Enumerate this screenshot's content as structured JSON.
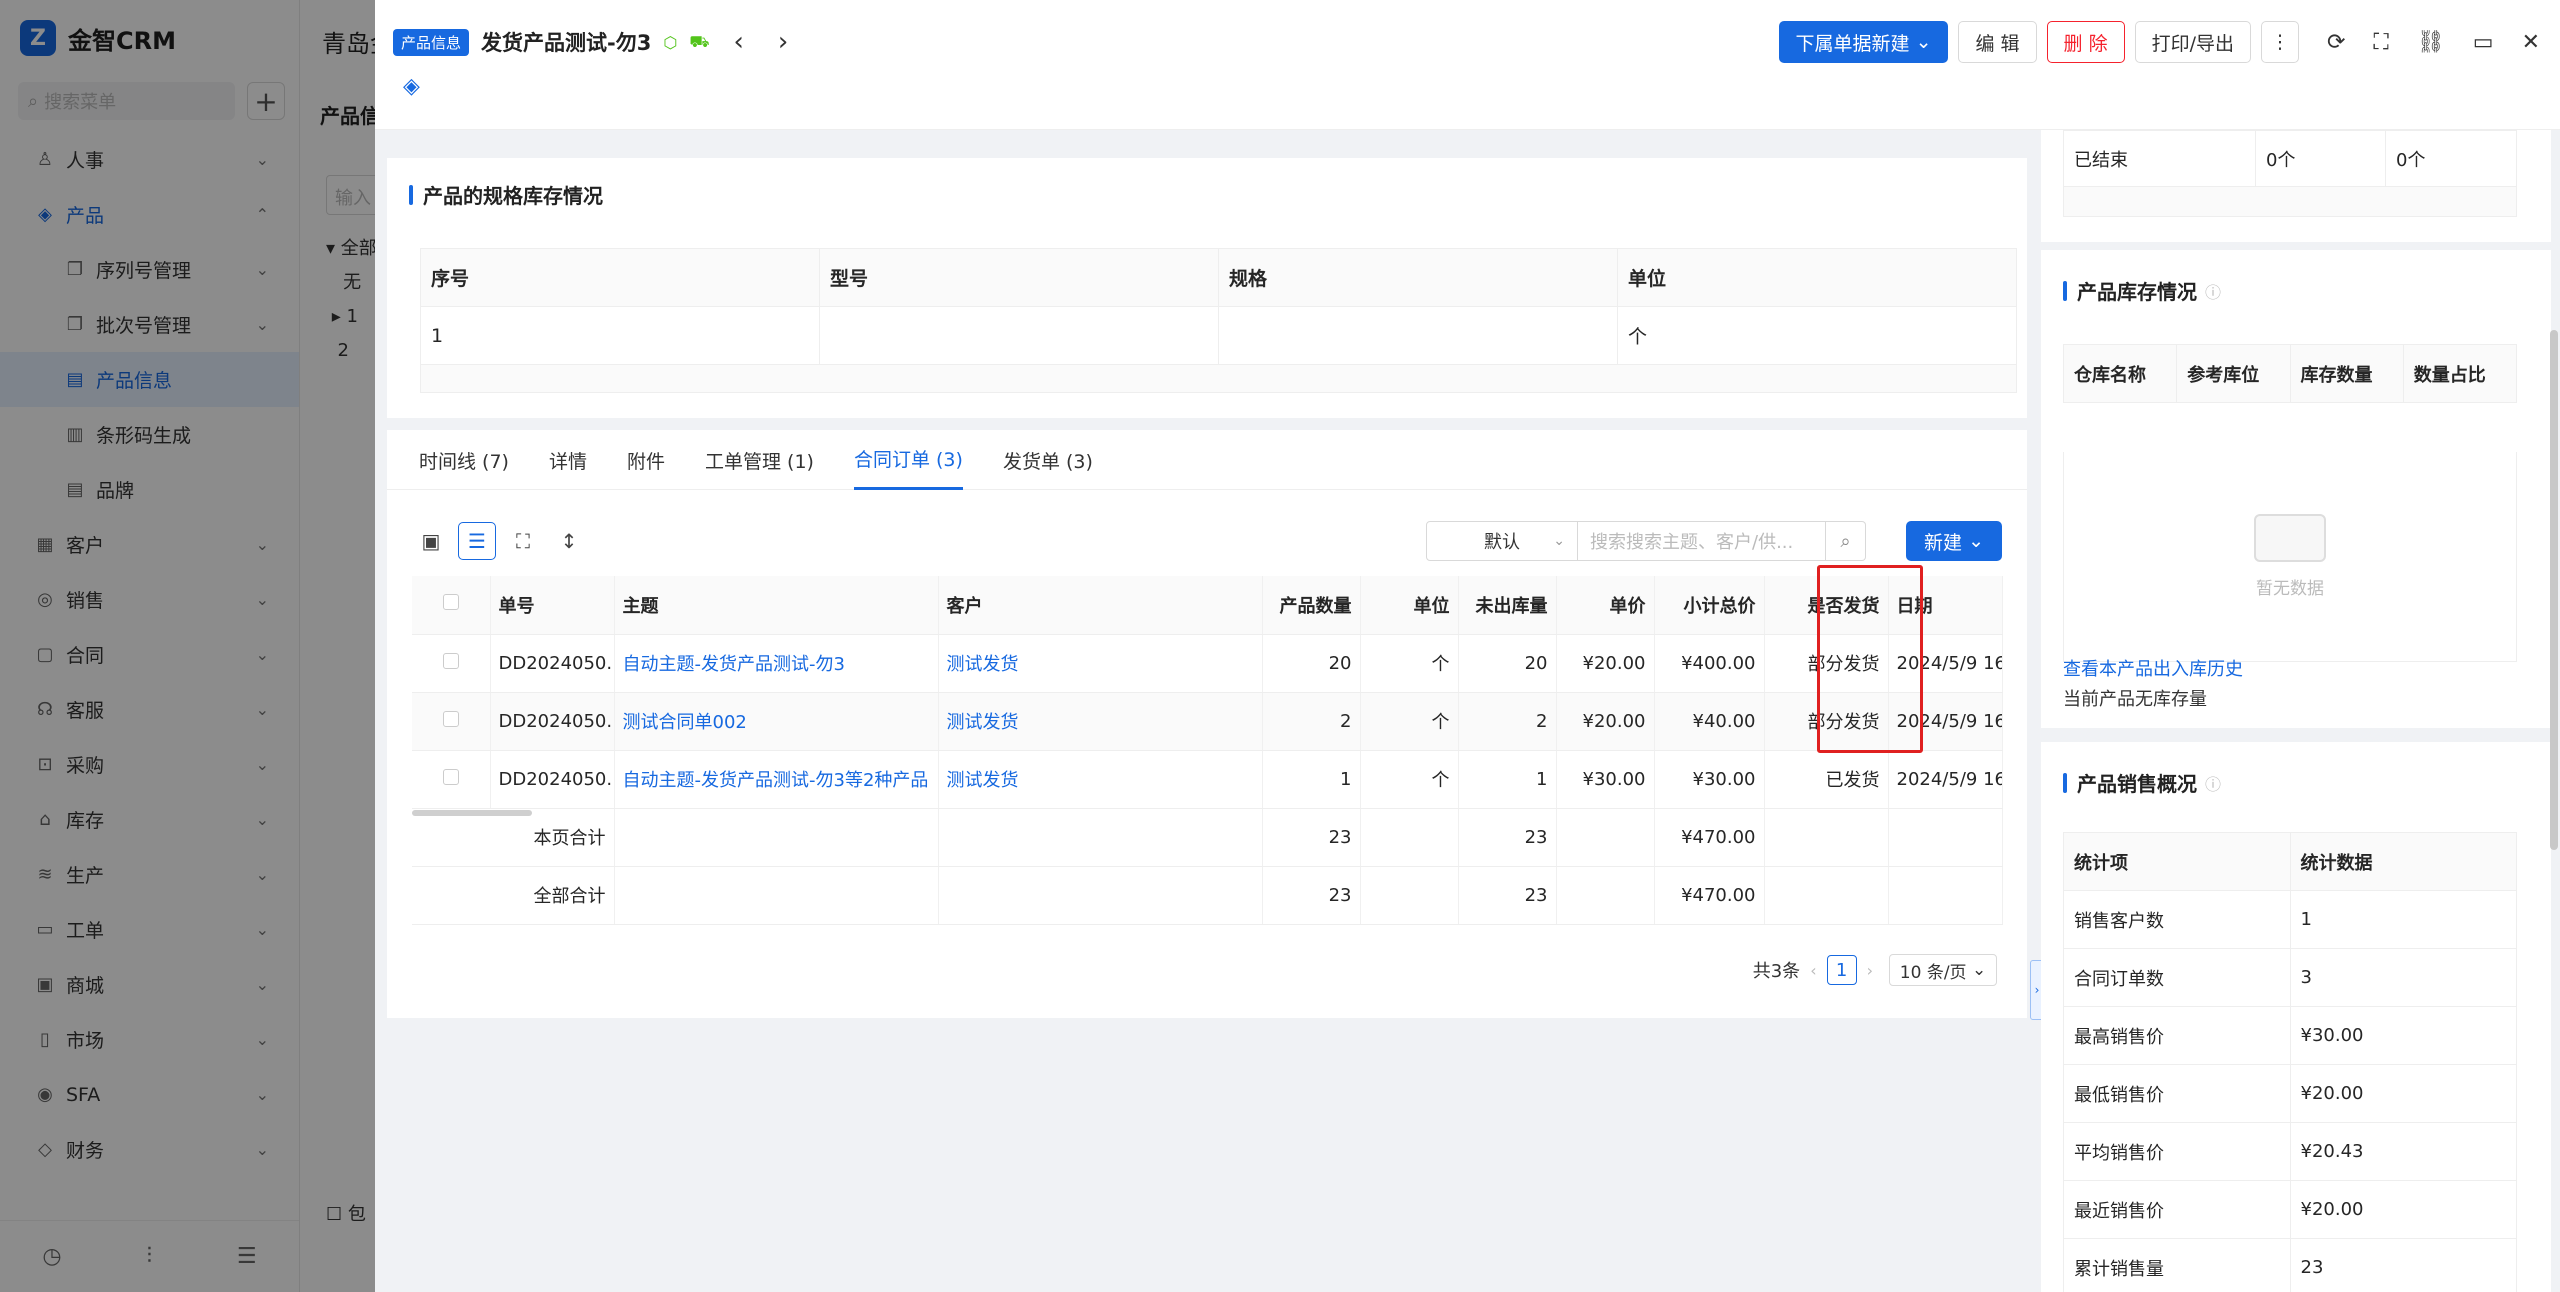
{
  "app": {
    "name": "金智CRM"
  },
  "sidebar": {
    "search_placeholder": "搜索菜单",
    "items": [
      {
        "label": "人事",
        "icon": "person-icon",
        "level": 1
      },
      {
        "label": "产品",
        "icon": "product-icon",
        "level": 1,
        "expanded": true
      },
      {
        "label": "序列号管理",
        "icon": "serial-icon",
        "level": 2
      },
      {
        "label": "批次号管理",
        "icon": "batch-icon",
        "level": 2
      },
      {
        "label": "产品信息",
        "icon": "doc-icon",
        "level": 2,
        "selected": true
      },
      {
        "label": "条形码生成",
        "icon": "barcode-icon",
        "level": 2
      },
      {
        "label": "品牌",
        "icon": "doc-icon",
        "level": 2
      },
      {
        "label": "客户",
        "icon": "customer-icon",
        "level": 1
      },
      {
        "label": "销售",
        "icon": "sales-icon",
        "level": 1
      },
      {
        "label": "合同",
        "icon": "contract-icon",
        "level": 1
      },
      {
        "label": "客服",
        "icon": "service-icon",
        "level": 1
      },
      {
        "label": "采购",
        "icon": "purchase-icon",
        "level": 1
      },
      {
        "label": "库存",
        "icon": "stock-icon",
        "level": 1
      },
      {
        "label": "生产",
        "icon": "production-icon",
        "level": 1
      },
      {
        "label": "工单",
        "icon": "workorder-icon",
        "level": 1
      },
      {
        "label": "商城",
        "icon": "mall-icon",
        "level": 1
      },
      {
        "label": "市场",
        "icon": "market-icon",
        "level": 1
      },
      {
        "label": "SFA",
        "icon": "sfa-icon",
        "level": 1
      },
      {
        "label": "财务",
        "icon": "finance-icon",
        "level": 1
      }
    ]
  },
  "background_page": {
    "title": "青岛金",
    "subtitle": "产品信",
    "input_placeholder": "输入",
    "tree": [
      "全部",
      "无",
      "1",
      "2"
    ],
    "checkbox_label": "包"
  },
  "drawer": {
    "tag": "产品信息",
    "title": "发货产品测试-勿3",
    "actions": {
      "sub_new": "下属单据新建",
      "edit": "编 辑",
      "delete": "删 除",
      "print": "打印/导出"
    },
    "spec_panel": {
      "title": "产品的规格库存情况",
      "columns": [
        "序号",
        "型号",
        "规格",
        "单位"
      ],
      "rows": [
        [
          "1",
          "",
          "",
          "个"
        ]
      ]
    },
    "tabs": [
      {
        "label": "时间线 (7)"
      },
      {
        "label": "详情"
      },
      {
        "label": "附件"
      },
      {
        "label": "工单管理 (1)"
      },
      {
        "label": "合同订单 (3)",
        "active": true
      },
      {
        "label": "发货单 (3)"
      }
    ],
    "order_toolbar": {
      "sort_default": "默认",
      "search_placeholder": "搜索搜索主题、客户/供...",
      "new_label": "新建"
    },
    "orders": {
      "columns": [
        "单号",
        "主题",
        "客户",
        "产品数量",
        "单位",
        "未出库量",
        "单价",
        "小计总价",
        "是否发货",
        "日期"
      ],
      "rows": [
        [
          "DD2024050...",
          "自动主题-发货产品测试-勿3",
          "测试发货",
          "20",
          "个",
          "20",
          "¥20.00",
          "¥400.00",
          "部分发货",
          "2024/5/9 16:"
        ],
        [
          "DD2024050...",
          "测试合同单002",
          "测试发货",
          "2",
          "个",
          "2",
          "¥20.00",
          "¥40.00",
          "部分发货",
          "2024/5/9 16:"
        ],
        [
          "DD2024050...",
          "自动主题-发货产品测试-勿3等2种产品",
          "测试发货",
          "1",
          "个",
          "1",
          "¥30.00",
          "¥30.00",
          "已发货",
          "2024/5/9 16:"
        ]
      ],
      "page_total": {
        "label": "本页合计",
        "qty": "23",
        "unshipped": "23",
        "amount": "¥470.00"
      },
      "all_total": {
        "label": "全部合计",
        "qty": "23",
        "unshipped": "23",
        "amount": "¥470.00"
      }
    },
    "pagination": {
      "total": "共3条",
      "current": "1",
      "page_size": "10 条/页"
    },
    "right": {
      "top_row": [
        "已结束",
        "0个",
        "0个"
      ],
      "stock": {
        "title": "产品库存情况",
        "columns": [
          "仓库名称",
          "参考库位",
          "库存数量",
          "数量占比"
        ],
        "empty_text": "暂无数据",
        "history_link": "查看本产品出入库历史",
        "note": "当前产品无库存量"
      },
      "sales": {
        "title": "产品销售概况",
        "columns": [
          "统计项",
          "统计数据"
        ],
        "rows": [
          [
            "销售客户数",
            "1"
          ],
          [
            "合同订单数",
            "3"
          ],
          [
            "最高销售价",
            "¥30.00"
          ],
          [
            "最低销售价",
            "¥20.00"
          ],
          [
            "平均销售价",
            "¥20.43"
          ],
          [
            "最近销售价",
            "¥20.00"
          ],
          [
            "累计销售量",
            "23"
          ]
        ]
      }
    }
  },
  "colors": {
    "primary": "#1769e0",
    "danger": "#f5222d",
    "highlight": "#e02020"
  }
}
